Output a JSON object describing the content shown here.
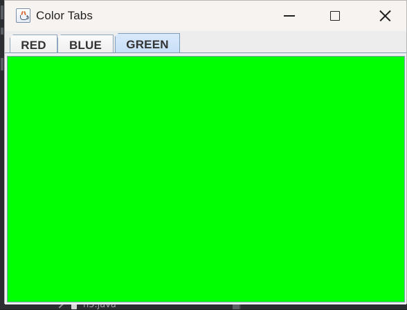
{
  "window": {
    "title": "Color Tabs",
    "icon": "java-cup-icon"
  },
  "controls": {
    "minimize_icon": "minimize-icon",
    "maximize_icon": "maximize-icon",
    "close_icon": "close-icon"
  },
  "tabs": [
    {
      "label": "RED",
      "selected": false
    },
    {
      "label": "BLUE",
      "selected": false
    },
    {
      "label": "GREEN",
      "selected": true
    }
  ],
  "panel": {
    "active_color": "#00ff00"
  },
  "colors": {
    "titlebar_bg": "#f7f3f1",
    "window_bg": "#f3f3f3",
    "tab_border": "#8ea6bf",
    "selected_tab_bg": "#cfe3f9",
    "green_panel": "#00ff00",
    "desktop_bg": "#1f2023"
  },
  "background_fragment": {
    "text": "n5.java"
  }
}
